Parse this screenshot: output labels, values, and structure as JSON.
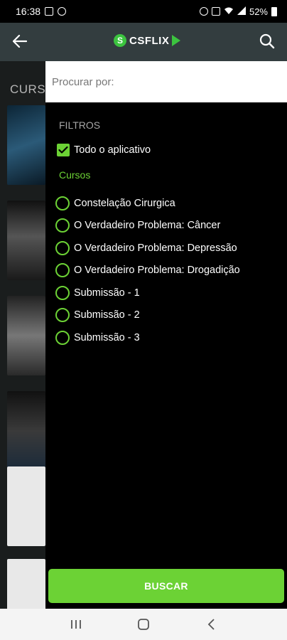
{
  "status": {
    "time": "16:38",
    "battery": "52%"
  },
  "header": {
    "logo_text": "CSFLIX",
    "logo_letter": "S"
  },
  "background": {
    "section_title": "CURSOS"
  },
  "search": {
    "placeholder": "Procurar por:"
  },
  "filters": {
    "heading": "FILTROS",
    "all_label": "Todo o aplicativo",
    "all_checked": true,
    "courses_heading": "Cursos",
    "courses": [
      {
        "label": "Constelação Cirurgica"
      },
      {
        "label": "O Verdadeiro Problema: Câncer"
      },
      {
        "label": "O Verdadeiro Problema: Depressão"
      },
      {
        "label": "O Verdadeiro Problema: Drogadição"
      },
      {
        "label": "Submissão - 1"
      },
      {
        "label": "Submissão - 2"
      },
      {
        "label": "Submissão - 3"
      }
    ]
  },
  "actions": {
    "search_button": "BUSCAR"
  },
  "colors": {
    "accent": "#6cd235",
    "app_bar": "#333d3f",
    "panel": "#000000"
  }
}
